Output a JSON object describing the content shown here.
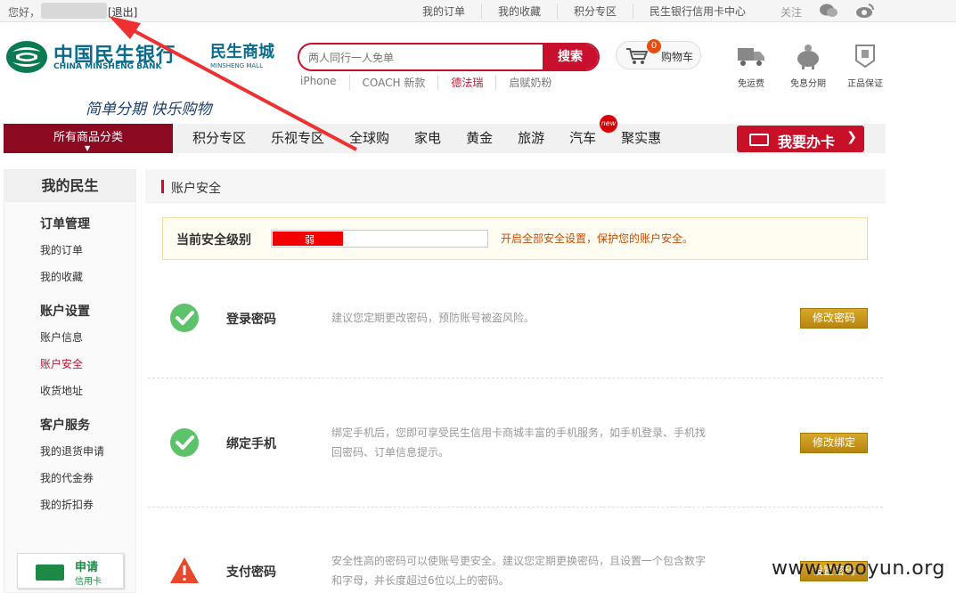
{
  "topbar": {
    "greeting": "您好，",
    "logout": "[退出]",
    "links": [
      "我的订单",
      "我的收藏",
      "积分专区",
      "民生银行信用卡中心"
    ],
    "follow": "关注",
    "social_icons": [
      "wechat-icon",
      "weibo-icon"
    ]
  },
  "header": {
    "bank_name_cn": "中国民生银行",
    "bank_name_en": "CHINA MINSHENG BANK",
    "mall_name_cn": "民生商城",
    "mall_name_en": "MINSHENG MALL",
    "slogan": "简单分期 快乐购物",
    "search": {
      "placeholder": "两人同行一人免单",
      "button": "搜索"
    },
    "hotwords": [
      "iPhone",
      "COACH 新款",
      "德法瑞",
      "启赋奶粉"
    ],
    "cart": {
      "label": "购物车",
      "count": "0"
    },
    "features": [
      "免运费",
      "免息分期",
      "正品保证"
    ]
  },
  "nav": {
    "all_categories": "所有商品分类",
    "items": [
      "积分专区",
      "乐视专区",
      "全球购",
      "家电",
      "黄金",
      "旅游",
      "汽车",
      "聚实惠"
    ],
    "new_tag": "new",
    "apply_card": "我要办卡"
  },
  "sidebar": {
    "title": "我的民生",
    "groups": [
      {
        "label": "订单管理",
        "items": [
          "我的订单",
          "我的收藏"
        ]
      },
      {
        "label": "账户设置",
        "items": [
          "账户信息",
          "账户安全",
          "收货地址"
        ]
      },
      {
        "label": "客户服务",
        "items": [
          "我的退货申请",
          "我的代金券",
          "我的折扣券"
        ]
      }
    ],
    "active_item": "账户安全",
    "apply": {
      "line1": "申请",
      "line2": "信用卡"
    }
  },
  "main": {
    "title": "账户安全",
    "level": {
      "label": "当前安全级别",
      "value_text": "弱",
      "fill_fraction": 0.33,
      "tip": "开启全部安全设置，保护您的账户安全。"
    },
    "rows": [
      {
        "name": "登录密码",
        "desc": "建议您定期更改密码，预防账号被盗风险。",
        "button": "修改密码",
        "status": "ok"
      },
      {
        "name": "绑定手机",
        "desc": "绑定手机后，您即可享受民生信用卡商城丰富的手机服务，如手机登录、手机找回密码、订单信息提示。",
        "button": "修改绑定",
        "status": "ok"
      },
      {
        "name": "支付密码",
        "desc": "安全性高的密码可以使账号更安全。建议您定期更换密码，且设置一个包含数字和字母，并长度超过6位以上的密码。",
        "button": "设置密码",
        "status": "warning"
      }
    ]
  },
  "watermark": "www.wooyun.org",
  "colors": {
    "brand_red": "#c8102e",
    "nav_dark_red": "#8b0a22",
    "brand_blue": "#0a6b8c",
    "ok_green": "#5cc36a",
    "warn_red": "#e8472c",
    "button_gold": "#c8961c"
  }
}
